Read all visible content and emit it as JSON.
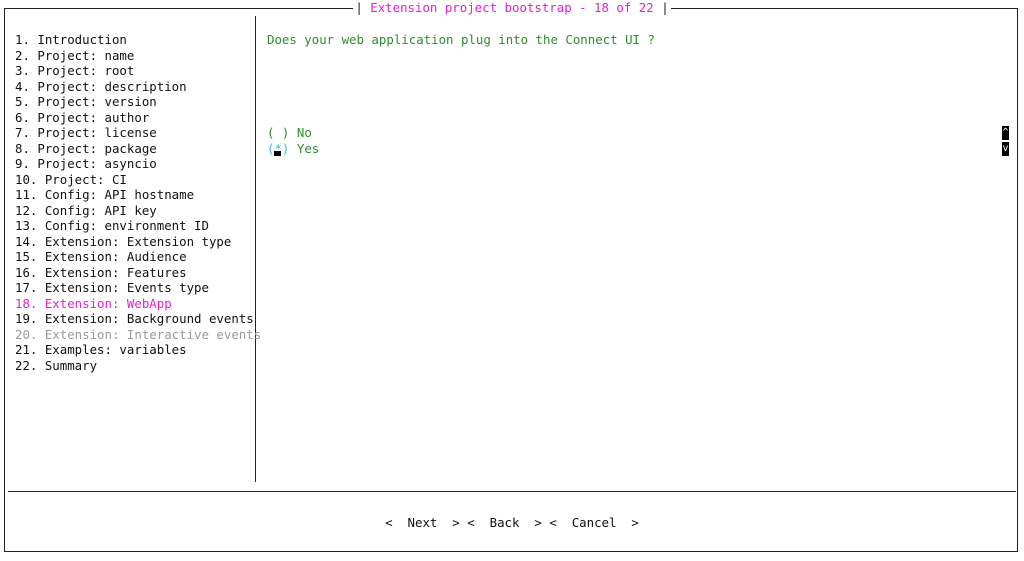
{
  "window": {
    "title": "Extension project bootstrap - 18 of 22"
  },
  "steps": [
    {
      "label": "1. Introduction",
      "state": "normal"
    },
    {
      "label": "2. Project: name",
      "state": "normal"
    },
    {
      "label": "3. Project: root",
      "state": "normal"
    },
    {
      "label": "4. Project: description",
      "state": "normal"
    },
    {
      "label": "5. Project: version",
      "state": "normal"
    },
    {
      "label": "6. Project: author",
      "state": "normal"
    },
    {
      "label": "7. Project: license",
      "state": "normal"
    },
    {
      "label": "8. Project: package",
      "state": "normal"
    },
    {
      "label": "9. Project: asyncio",
      "state": "normal"
    },
    {
      "label": "10. Project: CI",
      "state": "normal"
    },
    {
      "label": "11. Config: API hostname",
      "state": "normal"
    },
    {
      "label": "12. Config: API key",
      "state": "normal"
    },
    {
      "label": "13. Config: environment ID",
      "state": "normal"
    },
    {
      "label": "14. Extension: Extension type",
      "state": "normal"
    },
    {
      "label": "15. Extension: Audience",
      "state": "normal"
    },
    {
      "label": "16. Extension: Features",
      "state": "normal"
    },
    {
      "label": "17. Extension: Events type",
      "state": "normal"
    },
    {
      "label": "18. Extension: WebApp",
      "state": "current"
    },
    {
      "label": "19. Extension: Background events",
      "state": "normal"
    },
    {
      "label": "20. Extension: Interactive events",
      "state": "disabled"
    },
    {
      "label": "21. Examples: variables",
      "state": "normal"
    },
    {
      "label": "22. Summary",
      "state": "normal"
    }
  ],
  "main": {
    "question": "Does your web application plug into the Connect UI ?",
    "options": [
      {
        "marker": "( )",
        "label": "No",
        "selected": false
      },
      {
        "marker": "(*)",
        "label": "Yes",
        "selected": true
      }
    ],
    "scroll_up": "^",
    "scroll_down": "v"
  },
  "buttons": {
    "next": "<  Next  >",
    "back": "<  Back  >",
    "cancel": "<  Cancel  >"
  },
  "colors": {
    "accent_magenta": "#e020d0",
    "text_green": "#2e8b2e",
    "disabled_gray": "#9a9a9a",
    "selection_cyan": "#3fb8d8"
  }
}
